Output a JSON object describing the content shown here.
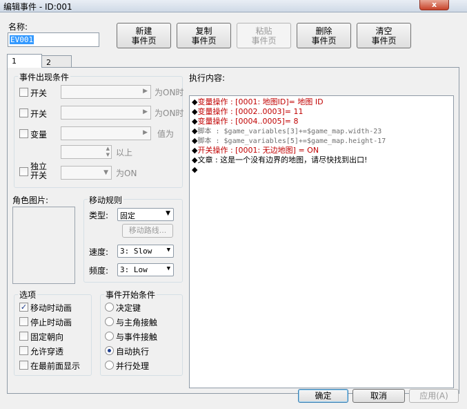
{
  "window": {
    "title": "编辑事件 - ID:001",
    "close_glyph": "x"
  },
  "name_label": "名称:",
  "name_value": "EV001",
  "buttons": {
    "new_page": [
      "新建",
      "事件页"
    ],
    "copy_page": [
      "复制",
      "事件页"
    ],
    "paste_page": [
      "粘贴",
      "事件页"
    ],
    "delete_page": [
      "删除",
      "事件页"
    ],
    "clear_page": [
      "清空",
      "事件页"
    ]
  },
  "tabs": [
    "1",
    "2"
  ],
  "conditions": {
    "title": "事件出现条件",
    "switch1": "开关",
    "switch1_suffix": "为ON时",
    "switch2": "开关",
    "switch2_suffix": "为ON时",
    "variable": "变量",
    "variable_suffix": "值为",
    "variable_above": "以上",
    "self_switch": [
      "独立",
      "开关"
    ],
    "self_switch_suffix": "为ON"
  },
  "graphic": {
    "title": "角色图片:"
  },
  "movement": {
    "title": "移动规则",
    "type_label": "类型:",
    "type_value": "固定",
    "route_button": "移动路线...",
    "speed_label": "速度:",
    "speed_value": "3: Slow",
    "freq_label": "频度:",
    "freq_value": "3: Low"
  },
  "options": {
    "title": "选项",
    "items": [
      {
        "label": "移动时动画",
        "checked": true
      },
      {
        "label": "停止时动画",
        "checked": false
      },
      {
        "label": "固定朝向",
        "checked": false
      },
      {
        "label": "允许穿透",
        "checked": false
      },
      {
        "label": "在最前面显示",
        "checked": false
      }
    ]
  },
  "trigger": {
    "title": "事件开始条件",
    "items": [
      {
        "label": "决定键",
        "selected": false
      },
      {
        "label": "与主角接触",
        "selected": false
      },
      {
        "label": "与事件接触",
        "selected": false
      },
      {
        "label": "自动执行",
        "selected": true
      },
      {
        "label": "并行处理",
        "selected": false
      }
    ]
  },
  "contents": {
    "title": "执行内容:",
    "bullet": "◆",
    "lines": [
      {
        "text": "变量操作 : [0001: 地图ID]= 地图 ID",
        "color": "red"
      },
      {
        "text": "变量操作 : [0002..0003]= 11",
        "color": "red"
      },
      {
        "text": "变量操作 : [0004..0005]= 8",
        "color": "red"
      },
      {
        "text": "脚本 : $game_variables[3]+=$game_map.width-23",
        "color": "gray"
      },
      {
        "text": "脚本 : $game_variables[5]+=$game_map.height-17",
        "color": "gray"
      },
      {
        "text": "开关操作 : [0001: 无边地图] = ON",
        "color": "red"
      },
      {
        "text": "文章 : 这是一个没有边界的地图，请尽快找到出口!",
        "color": "black"
      },
      {
        "text": "",
        "color": "black"
      }
    ]
  },
  "footer": {
    "ok": "确定",
    "cancel": "取消",
    "apply": "应用(A)"
  },
  "colors": {
    "script_red": "#c00000",
    "script_gray": "#6e6e6e",
    "accent": "#1f3f8f"
  }
}
